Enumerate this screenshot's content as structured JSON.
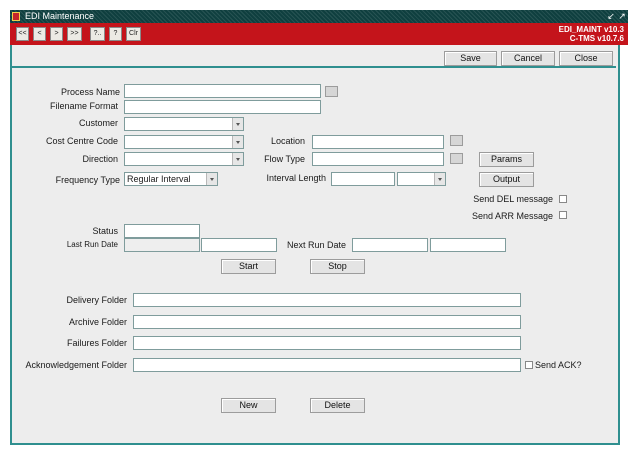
{
  "window": {
    "title": "EDI Maintenance"
  },
  "app": {
    "id": "EDI_MAINT v10.3",
    "version": "C-TMS v10.7.6"
  },
  "nav": {
    "first": "<<",
    "prev": "<",
    "next": ">",
    "last": ">>",
    "query": "?..",
    "help": "?",
    "clear": "Clr"
  },
  "toolbar": {
    "save": "Save",
    "cancel": "Cancel",
    "close": "Close"
  },
  "form": {
    "process_name": {
      "label": "Process Name",
      "value": ""
    },
    "filename_format": {
      "label": "Filename Format",
      "value": ""
    },
    "customer": {
      "label": "Customer",
      "value": ""
    },
    "cost_centre": {
      "label": "Cost Centre Code",
      "value": ""
    },
    "location": {
      "label": "Location",
      "value": ""
    },
    "direction": {
      "label": "Direction",
      "value": ""
    },
    "flow_type": {
      "label": "Flow Type",
      "value": ""
    },
    "params_button": "Params",
    "frequency": {
      "label": "Frequency Type",
      "value": "Regular Interval"
    },
    "interval": {
      "label": "Interval Length",
      "value": "",
      "unit": ""
    },
    "output_button": "Output",
    "send_del": {
      "label": "Send DEL message",
      "checked": false
    },
    "send_arr": {
      "label": "Send ARR Message",
      "checked": false
    },
    "status": {
      "label": "Status",
      "value": ""
    },
    "last_run": {
      "label": "Last Run Date",
      "date": "",
      "time": ""
    },
    "next_run": {
      "label": "Next Run Date",
      "date": "",
      "time": ""
    },
    "start_button": "Start",
    "stop_button": "Stop",
    "delivery_folder": {
      "label": "Delivery Folder",
      "value": ""
    },
    "archive_folder": {
      "label": "Archive Folder",
      "value": ""
    },
    "failures_folder": {
      "label": "Failures Folder",
      "value": ""
    },
    "ack_folder": {
      "label": "Acknowledgement Folder",
      "value": ""
    },
    "send_ack": {
      "label": "Send ACK?",
      "checked": false
    },
    "new_button": "New",
    "delete_button": "Delete"
  }
}
